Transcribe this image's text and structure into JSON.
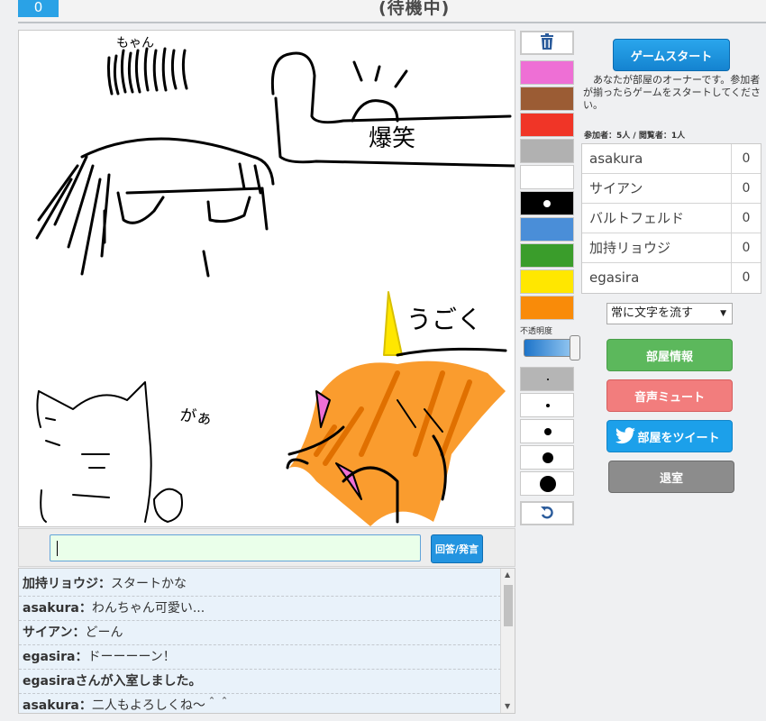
{
  "header": {
    "score": "0",
    "status": "(待機中)"
  },
  "canvas": {
    "texts": {
      "chan": "もゃん",
      "bakushou": "爆笑",
      "ugoku": "うごく",
      "gaa": "がぁ"
    }
  },
  "palette": {
    "colors": [
      "#ee6fd5",
      "#9b5c34",
      "#f03527",
      "#b1b1b1",
      "#ffffff",
      "#000000",
      "#4a8ed8",
      "#3a9d2b",
      "#ffe700",
      "#f98b09"
    ],
    "opacity_label": "不透明度",
    "brush_sizes": [
      "xs",
      "s",
      "m",
      "l",
      "xl"
    ]
  },
  "answer": {
    "input_value": "",
    "button_label": "回答/発言"
  },
  "chat": {
    "messages": [
      {
        "user": "加持リョウジ",
        "text": "スタートかな"
      },
      {
        "user": "asakura",
        "text": "わんちゃん可愛い..."
      },
      {
        "user": "サイアン",
        "text": "どーん"
      },
      {
        "user": "egasira",
        "text": "ドーーーーン！"
      },
      {
        "user": "",
        "text": "egasiraさんが入室しました。"
      },
      {
        "user": "asakura",
        "text": "二人もよろしくね～＾＾"
      }
    ]
  },
  "sidebar": {
    "start_button": "ゲームスタート",
    "owner_note": "あなたが部屋のオーナーです。参加者が揃ったらゲームをスタートしてください。",
    "counts": "参加者：5人 / 閲覧者：1人",
    "players": [
      {
        "name": "asakura",
        "score": "0"
      },
      {
        "name": "サイアン",
        "score": "0"
      },
      {
        "name": "バルトフェルド",
        "score": "0"
      },
      {
        "name": "加持リョウジ",
        "score": "0"
      },
      {
        "name": "egasira",
        "score": "0"
      }
    ],
    "scroll_option": "常に文字を流す",
    "room_info_button": "部屋情報",
    "mute_button": "音声ミュート",
    "tweet_button": "部屋をツイート",
    "leave_button": "退室"
  },
  "icons": {
    "trash": "trash-icon",
    "undo": "undo-icon",
    "twitter": "twitter-bird-icon"
  }
}
